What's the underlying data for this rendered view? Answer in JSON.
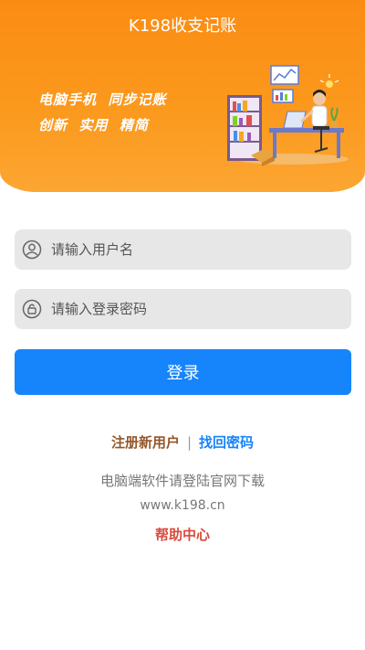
{
  "app": {
    "title": "K198收支记账"
  },
  "banner": {
    "slogan_line1": "电脑手机  同步记账",
    "slogan_line2": "创新  实用  精简"
  },
  "form": {
    "username_placeholder": "请输入用户名",
    "password_placeholder": "请输入登录密码",
    "login_label": "登录"
  },
  "links": {
    "register": "注册新用户",
    "separator": "|",
    "forgot_password": "找回密码"
  },
  "footer": {
    "desktop_note": "电脑端软件请登陆官网下载",
    "website": "www.k198.cn",
    "help": "帮助中心"
  },
  "colors": {
    "header": "#fb8c13",
    "primary": "#1684fb",
    "register_link": "#94562a",
    "help_link": "#d84b3b"
  },
  "icons": {
    "username": "user-icon",
    "password": "lock-icon"
  }
}
